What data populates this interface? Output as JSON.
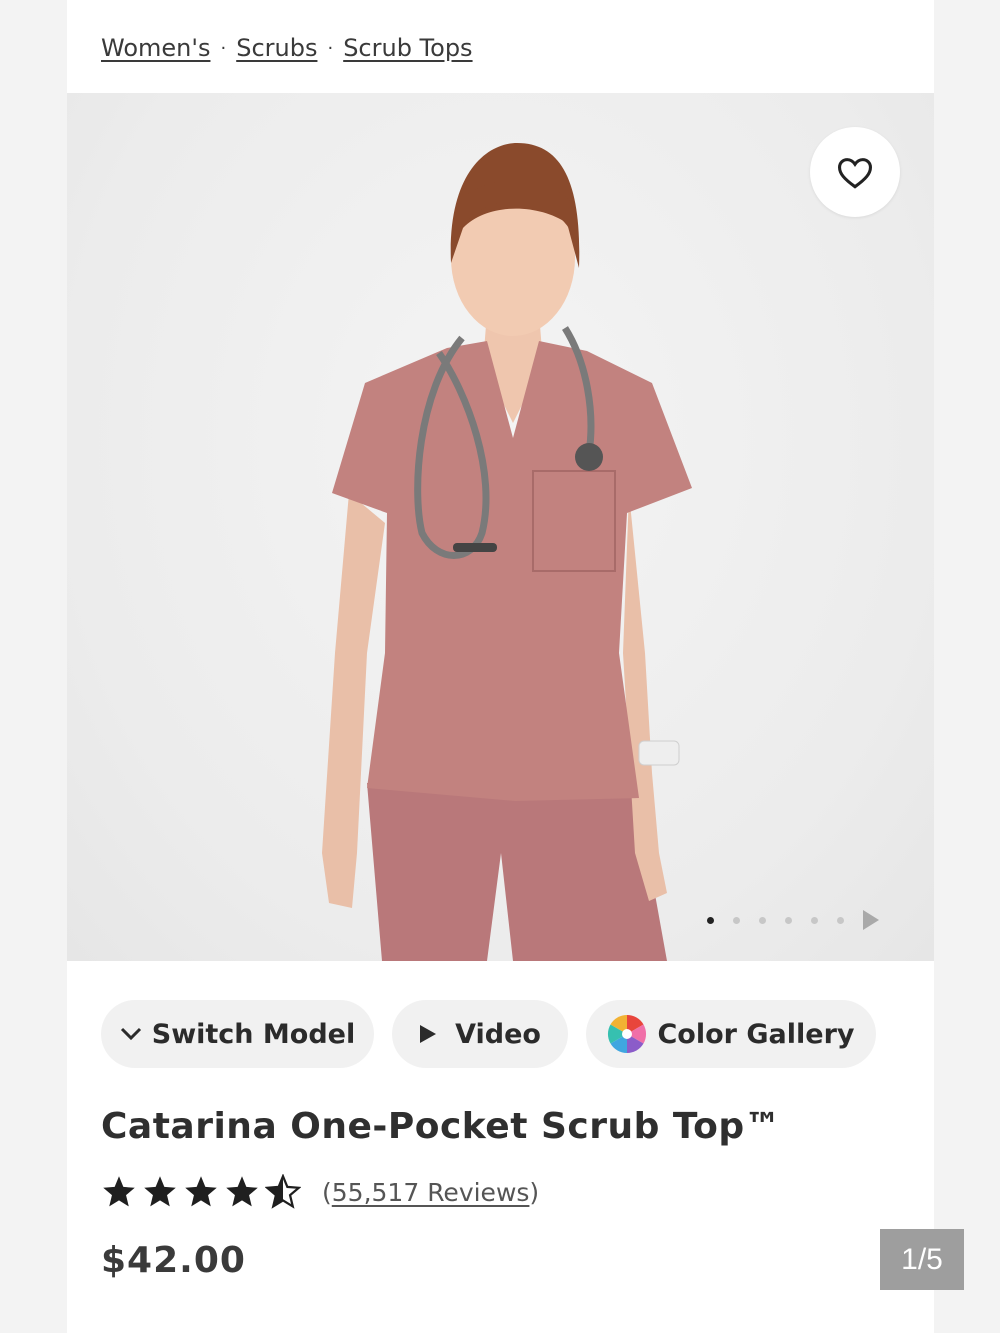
{
  "breadcrumb": {
    "items": [
      "Women's",
      "Scrubs",
      "Scrub Tops"
    ],
    "separator": "·"
  },
  "gallery": {
    "active_index": 0,
    "dot_count": 6,
    "image_alt": "Model wearing mauve Catarina One-Pocket Scrub Top with stethoscope",
    "scrub_color": "#c2827f"
  },
  "actions": {
    "switch_model": "Switch Model",
    "video": "Video",
    "color_gallery": "Color Gallery"
  },
  "product": {
    "title": "Catarina One-Pocket Scrub Top™",
    "rating": 4.5,
    "rating_max": 5,
    "reviews_count": "55,517 Reviews",
    "price": "$42.00"
  },
  "pager": {
    "label": "1/5"
  },
  "colors": {
    "text": "#2b2b2b",
    "chip_bg": "#f1f1f1",
    "pager_bg": "#9e9e9e"
  }
}
